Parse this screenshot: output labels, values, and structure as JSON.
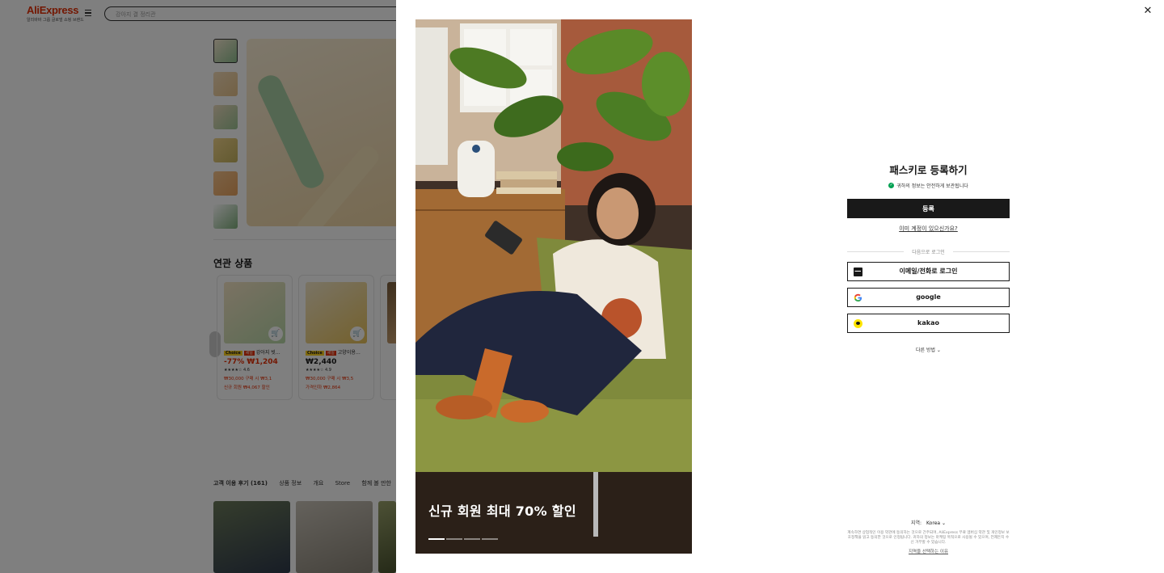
{
  "background_page": {
    "logo": "AliExpress",
    "logo_sub": "알리바바 그룹 글로벌 쇼핑 브랜드",
    "search_placeholder": "강아지 결 정리관",
    "related_title": "연관 상품",
    "cards": [
      {
        "badge": "Choice",
        "badge2": "세일",
        "name": "강아지 빗…",
        "price": "-77% ₩1,204",
        "rating": "★★★★☆ 4.6",
        "coupon": "₩30,000 구매 시 ₩3,1",
        "promo": "신규 회원 ₩4,067 할인"
      },
      {
        "badge": "Choice",
        "badge2": "세일",
        "name": "고양이용…",
        "price": "₩2,440",
        "rating": "★★★★☆ 4.9",
        "coupon": "₩30,000 구매 시 ₩3,5",
        "promo": "가격인하 ₩2,864"
      }
    ],
    "tabs": [
      "고객 이용 후기 (161)",
      "상품 정보",
      "개요",
      "Store",
      "함께 볼 만한"
    ]
  },
  "modal": {
    "close_icon": "close-icon",
    "banner_text": "신규 회원 최대 70% 할인",
    "title": "패스키로 등록하기",
    "secure_text": "귀하의 정보는 안전하게 보관됩니다",
    "register_label": "등록",
    "have_account": "이미 계정이 있으신가요?",
    "or_label": "다음으로 로그인",
    "login_buttons": [
      {
        "icon": "mail-icon",
        "label": "이메일/전화로 로그인"
      },
      {
        "icon": "google-icon",
        "label": "google"
      },
      {
        "icon": "kakao-icon",
        "label": "kakao"
      }
    ],
    "more_label": "다른 방법 ⌄",
    "region_label": "지역:",
    "region_value": "Korea ⌄",
    "terms": "계속하면 상업적인 이용 약관에 동의하는 것으로 간주되며, AliExpress 무료 멤버십 약관 및 개인정보 보호정책을 읽고 동의한 것으로 인정됩니다. 귀하의 정보는 마케팅 목적으로 사용될 수 있으며, 언제든지 수신 거부할 수 있습니다.",
    "why_region": "지역을 선택하는 이유"
  }
}
